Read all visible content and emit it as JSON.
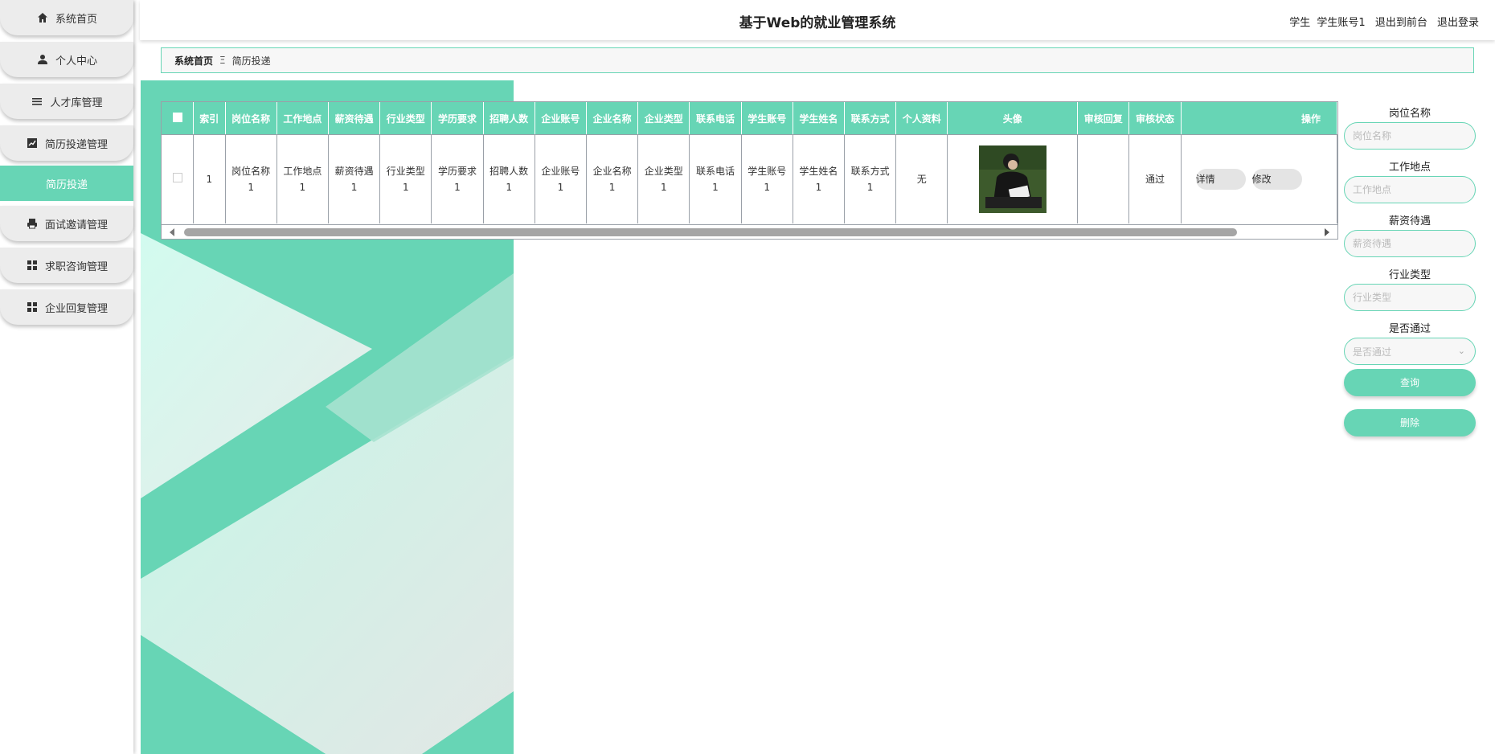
{
  "app": {
    "title": "基于Web的就业管理系统"
  },
  "colors": {
    "accent": "#67d5b5",
    "menu_bg": "#ececec"
  },
  "header": {
    "role": "学生",
    "account": "学生账号1",
    "to_front": "退出到前台",
    "logout": "退出登录"
  },
  "sidebar": {
    "items": [
      {
        "label": "系统首页",
        "icon": "home-icon"
      },
      {
        "label": "个人中心",
        "icon": "user-icon"
      },
      {
        "label": "人才库管理",
        "icon": "list-icon"
      },
      {
        "label": "简历投递管理",
        "icon": "chart-icon"
      },
      {
        "label": "简历投递",
        "icon": "",
        "active": true
      },
      {
        "label": "面试邀请管理",
        "icon": "printer-icon"
      },
      {
        "label": "求职咨询管理",
        "icon": "grid-icon"
      },
      {
        "label": "企业回复管理",
        "icon": "grid-icon"
      }
    ]
  },
  "breadcrumb": {
    "home": "系统首页",
    "separator": "Ξ",
    "current": "简历投递"
  },
  "table": {
    "headers": [
      "",
      "索引",
      "岗位名称",
      "工作地点",
      "薪资待遇",
      "行业类型",
      "学历要求",
      "招聘人数",
      "企业账号",
      "企业名称",
      "企业类型",
      "联系电话",
      "学生账号",
      "学生姓名",
      "联系方式",
      "个人资料",
      "头像",
      "审核回复",
      "审核状态",
      "操作"
    ],
    "rows": [
      {
        "index": "1",
        "gangwei": [
          "岗位名称",
          "1"
        ],
        "didian": [
          "工作地点",
          "1"
        ],
        "xinzi": [
          "薪资待遇",
          "1"
        ],
        "hangye": [
          "行业类型",
          "1"
        ],
        "xueli": [
          "学历要求",
          "1"
        ],
        "renshu": [
          "招聘人数",
          "1"
        ],
        "qiye_zhanghao": [
          "企业账号",
          "1"
        ],
        "qiye_mingcheng": [
          "企业名称",
          "1"
        ],
        "qiye_leixing": [
          "企业类型",
          "1"
        ],
        "dianhua": [
          "联系电话",
          "1"
        ],
        "xuesheng_zhanghao": [
          "学生账号",
          "1"
        ],
        "xuesheng_xingming": [
          "学生姓名",
          "1"
        ],
        "lianxi": [
          "联系方式",
          "1"
        ],
        "ziliao": "无",
        "avatar": "avatar-photo",
        "huifu": "",
        "zhuangtai": "通过",
        "actions": [
          "详情",
          "修改"
        ]
      }
    ]
  },
  "search": {
    "fields": [
      {
        "label": "岗位名称",
        "placeholder": "岗位名称"
      },
      {
        "label": "工作地点",
        "placeholder": "工作地点"
      },
      {
        "label": "薪资待遇",
        "placeholder": "薪资待遇"
      },
      {
        "label": "行业类型",
        "placeholder": "行业类型"
      }
    ],
    "select": {
      "label": "是否通过",
      "placeholder": "是否通过"
    },
    "query_label": "查询",
    "delete_label": "删除"
  }
}
